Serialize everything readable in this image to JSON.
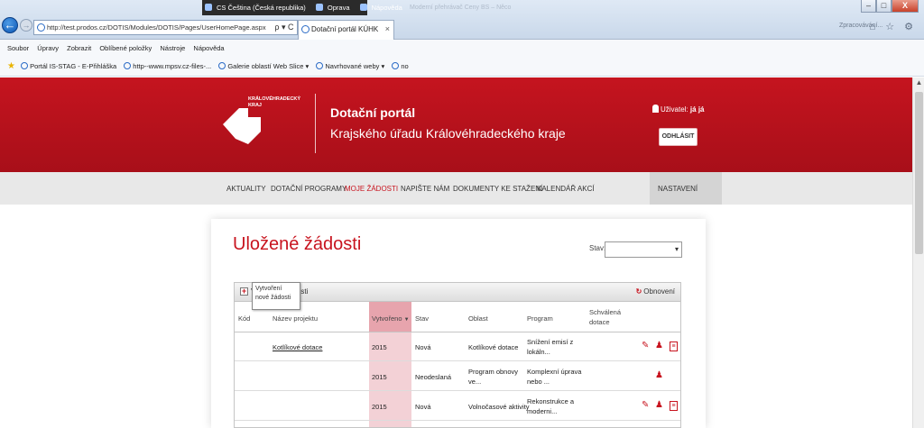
{
  "browser": {
    "url": "http://test.prodos.cz/DOTIS/Modules/DOTIS/Pages/UserHomePage.aspx",
    "url_host_bold": "prodos.cz",
    "addr_tools": "ρ ▾ C",
    "tab_title": "Dotační portál KÚHK",
    "tab_close": "×",
    "back_icon": "←",
    "forward_icon": "→",
    "ghost_tab": "Moderní přehrávač Ceny BS – Něco",
    "right_ghost": "Zpracovávání...",
    "lang_items": [
      "CS Čeština (Česká republika)",
      "Oprava",
      "Nápověda"
    ],
    "window_buttons": [
      "–",
      "□",
      "X"
    ],
    "chrome_icons": "⌂ ☆ ⚙",
    "menu": [
      "Soubor",
      "Úpravy",
      "Zobrazit",
      "Oblíbené položky",
      "Nástroje",
      "Nápověda"
    ],
    "favorites": [
      "Portál IS-STAG - E-Přihláška",
      "http--www.mpsv.cz-files-...",
      "Galerie oblastí Web Slice ▾",
      "Navrhované weby ▾",
      "no"
    ]
  },
  "header": {
    "logo_text_1": "KRÁLOVÉHRADECKÝ",
    "logo_text_2": "KRAJ",
    "title": "Dotační portál",
    "subtitle": "Krajského úřadu Královéhradeckého kraje",
    "user_label": "Uživatel:",
    "user_name": "já já",
    "logout": "ODHLÁSIT",
    "brand_color": "#c8141f"
  },
  "nav": {
    "items": [
      "AKTUALITY",
      "DOTAČNÍ PROGRAMY",
      "MOJE ŽÁDOSTI",
      "NAPIŠTE NÁM",
      "DOKUMENTY KE STAŽENÍ",
      "KALENDÁŘ AKCÍ"
    ],
    "active": "MOJE ŽÁDOSTI",
    "settings": "NASTAVENÍ"
  },
  "page": {
    "title": "Uložené žádosti",
    "filter_label": "Stav:",
    "filter_value": ""
  },
  "grid": {
    "add_label_prefix": "V",
    "add_label_suffix": "sti",
    "tooltip": "Vytvoření nové žádosti",
    "refresh": "Obnovení",
    "columns": [
      "Kód",
      "Název projektu",
      "Vytvořeno",
      "Stav",
      "Oblast",
      "Program",
      "Schválená dotace"
    ],
    "sort_indicator": "▼",
    "rows": [
      {
        "code": "",
        "name": "Kotlíkové dotace",
        "created": "2015",
        "status": "Nová",
        "area": "Kotlíkové dotace",
        "program_1": "Snížení emisí z",
        "program_2": "lokáln...",
        "approved": "",
        "actions": [
          "edit-icon",
          "user-icon",
          "pdf-icon"
        ]
      },
      {
        "code": "",
        "name": "",
        "created": "2015",
        "status": "Neodeslaná",
        "area_1": "Program obnovy",
        "area_2": "ve...",
        "program_1": "Komplexní úprava",
        "program_2": "nebo ...",
        "approved": "",
        "actions": [
          "user-icon"
        ]
      },
      {
        "code": "",
        "name": "",
        "created": "2015",
        "status": "Nová",
        "area": "Volnočasové aktivity",
        "program_1": "Rekonstrukce a",
        "program_2": "moderni...",
        "approved": "",
        "actions": [
          "edit-icon",
          "user-icon",
          "pdf-icon"
        ]
      }
    ]
  }
}
